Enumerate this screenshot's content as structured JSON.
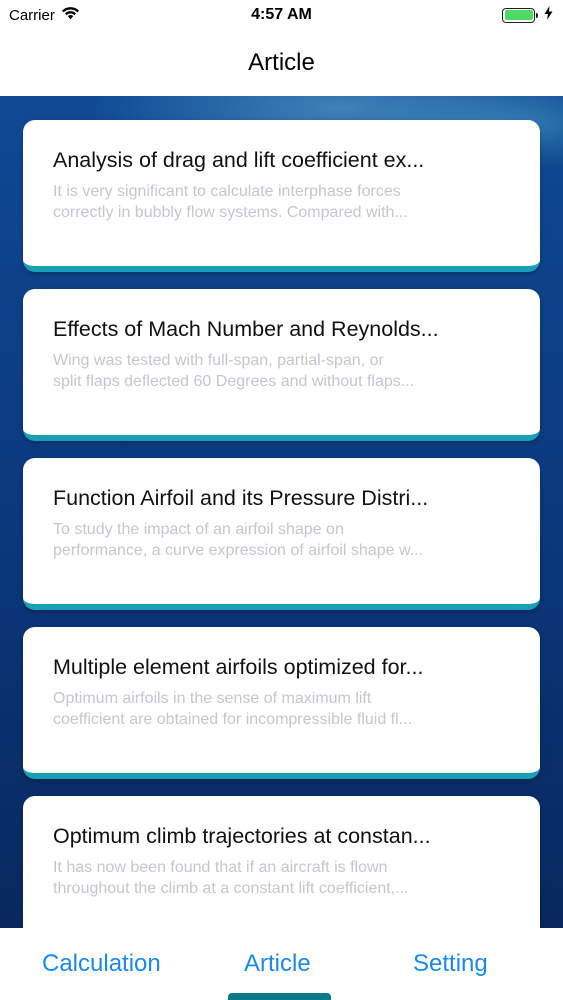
{
  "status_bar": {
    "carrier": "Carrier",
    "time": "4:57 AM",
    "battery_level": 1.0,
    "icons": [
      "wifi-icon",
      "battery-icon",
      "charging-bolt-icon"
    ]
  },
  "nav": {
    "title": "Article"
  },
  "articles": [
    {
      "title": "Analysis of drag and lift coefficient ex...",
      "summary": [
        "It is very significant to calculate interphase forces",
        "correctly in bubbly flow systems. Compared with..."
      ]
    },
    {
      "title": "Effects of Mach Number and Reynolds...",
      "summary": [
        "Wing was tested with full-span, partial-span, or",
        "split flaps deflected 60 Degrees and without flaps..."
      ]
    },
    {
      "title": "Function Airfoil and its Pressure Distri...",
      "summary": [
        "To study the impact of an airfoil shape on",
        "performance, a curve expression of airfoil shape w..."
      ]
    },
    {
      "title": "Multiple element airfoils optimized for...",
      "summary": [
        "Optimum airfoils in the sense of maximum lift",
        "coefficient are obtained for incompressible fluid fl..."
      ]
    },
    {
      "title": "Optimum climb trajectories at constan...",
      "summary": [
        "It has now been found that if an aircraft is flown",
        "throughout the climb at a constant lift coefficient,..."
      ]
    }
  ],
  "tabs": [
    {
      "label": "Calculation",
      "active": false
    },
    {
      "label": "Article",
      "active": true
    },
    {
      "label": "Setting",
      "active": false
    }
  ],
  "colors": {
    "tab_text": "#1e88e5",
    "tab_indicator": "#0b7a86",
    "card_accent": "#1aa0b6",
    "background_dark": "#0a3577",
    "summary_text": "#c4c7cc"
  }
}
